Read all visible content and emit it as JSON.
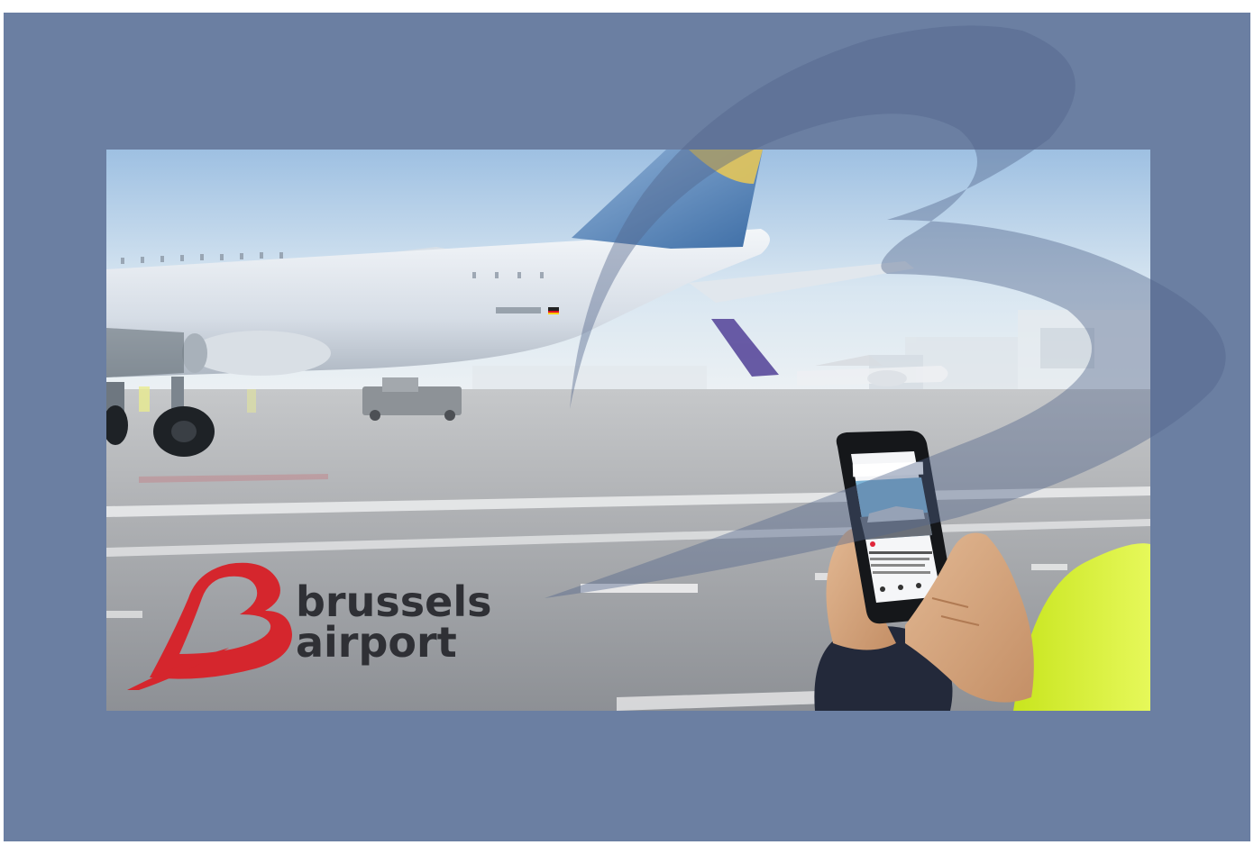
{
  "colors": {
    "background": "#6b7fa2",
    "logo_red": "#d5262d",
    "logo_text": "#2f3035",
    "sky_top": "#a9c8e6",
    "tarmac": "#a7a9ad",
    "safety_vest": "#d8f22e"
  },
  "logo": {
    "line1": "brussels",
    "line2": "airport"
  }
}
